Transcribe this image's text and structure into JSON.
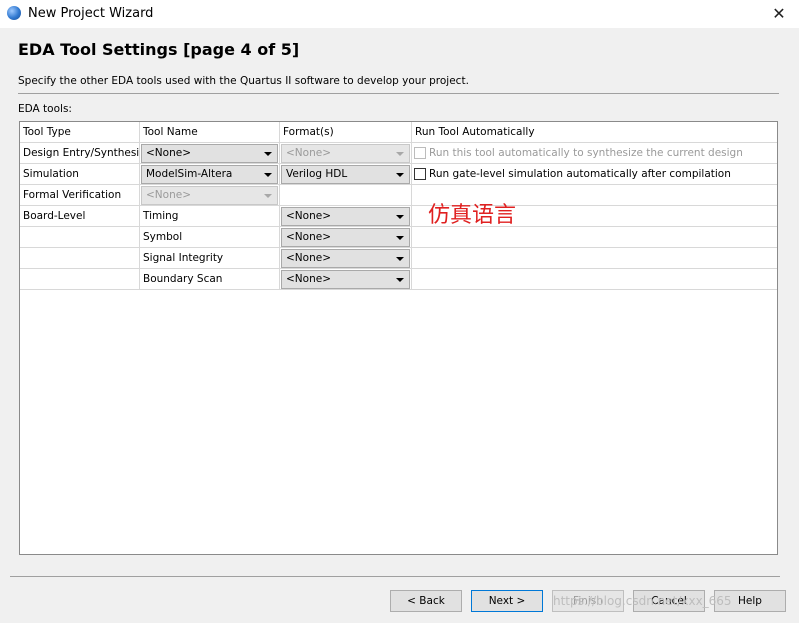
{
  "window": {
    "title": "New Project Wizard",
    "close_glyph": "✕"
  },
  "header": {
    "title": "EDA Tool Settings [page 4 of 5]",
    "description": "Specify the other EDA tools used with the Quartus II software to develop your project."
  },
  "eda_tools_label": "EDA tools:",
  "table": {
    "columns": [
      "Tool Type",
      "Tool Name",
      "Format(s)",
      "Run Tool Automatically"
    ],
    "rows": [
      {
        "type": "Design Entry/Synthesis",
        "tool": "<None>",
        "format": "<None>",
        "run_label": "Run this tool automatically to synthesize the current design"
      },
      {
        "type": "Simulation",
        "tool": "ModelSim-Altera",
        "format": "Verilog HDL",
        "run_label": "Run gate-level simulation automatically after compilation"
      },
      {
        "type": "Formal Verification",
        "tool": "<None>"
      },
      {
        "type": "Board-Level",
        "tool": "Timing",
        "format": "<None>"
      },
      {
        "type": "",
        "tool": "Symbol",
        "format": "<None>"
      },
      {
        "type": "",
        "tool": "Signal Integrity",
        "format": "<None>"
      },
      {
        "type": "",
        "tool": "Boundary Scan",
        "format": "<None>"
      }
    ]
  },
  "annotation": "仿真语言",
  "buttons": {
    "back": "< Back",
    "next": "Next >",
    "finish": "Finish",
    "cancel": "Cancel",
    "help": "Help"
  },
  "watermark": "https://blog.csdn.net/xxx_665"
}
